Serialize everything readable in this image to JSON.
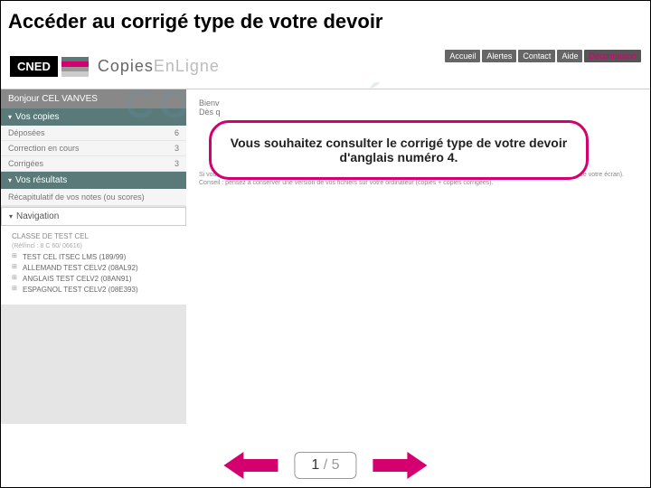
{
  "title": "Accéder au corrigé type de votre devoir",
  "logo_text": "CNED",
  "brand_a": "Copies",
  "brand_b": "EnLigne",
  "bg_watermark": "CONNECTÉ AU C",
  "topnav": [
    "Accueil",
    "Alertes",
    "Contact",
    "Aide",
    "Déconnexion"
  ],
  "sidebar": {
    "greeting": "Bonjour CEL VANVES",
    "section_copies": "Vos copies",
    "rows": [
      {
        "label": "Déposées",
        "value": "6"
      },
      {
        "label": "Correction en cours",
        "value": "3"
      },
      {
        "label": "Corrigées",
        "value": "3"
      }
    ],
    "section_results": "Vos résultats",
    "recap": "Récapitulatif de vos notes (ou scores)",
    "nav_header": "Navigation",
    "tree_root": "CLASSE DE TEST CEL",
    "tree_sub": "(Réf/incl : 8 C 60/ 06616)",
    "tree_children": [
      "TEST CEL ITSEC LMS (189/99)",
      "ALLEMAND TEST CELV2 (08AL92)",
      "ANGLAIS TEST CELV2 (08AN91)",
      "ESPAGNOL TEST CELV2 (08E393)"
    ]
  },
  "main": {
    "welcome_l1": "Bienv",
    "welcome_l2": "Dès q",
    "help_l1": "Si vous avez besoin d'aide pour utiliser cette application, téléchargez le mode d'emploi en cliquant sur la rubrique Aide (en haut à droite de votre écran).",
    "help_l2": "Conseil : pensez à conserver une version de vos fichiers sur votre ordinateur (copies + copies corrigées)."
  },
  "callout": "Vous souhaitez consulter le corrigé type de votre devoir d'anglais numéro 4.",
  "pager": {
    "current": "1",
    "sep": "/",
    "total": "5"
  }
}
